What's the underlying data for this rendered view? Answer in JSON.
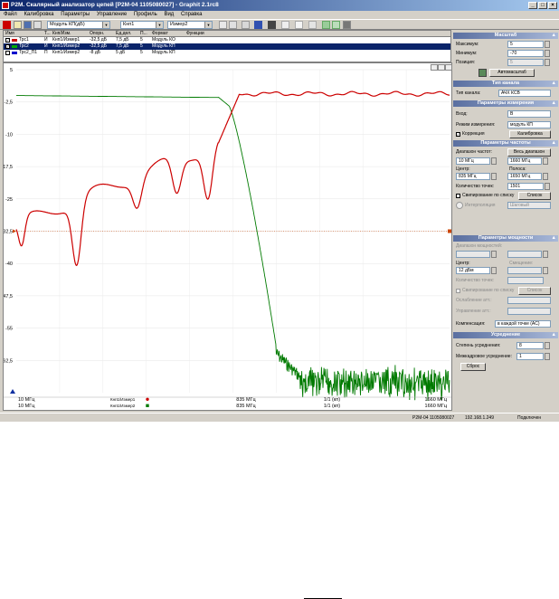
{
  "window": {
    "title": "P2M. Скалярный анализатор цепей [P2M-04 1105080027] - Graphit 2.1rc8",
    "controls": [
      "_",
      "□",
      "×"
    ]
  },
  "menu": [
    "Файл",
    "Калибровка",
    "Параметры",
    "Управление",
    "Профиль",
    "Вид",
    "Справка"
  ],
  "toolbar": {
    "mode_select": "Модуль КП(дБ)",
    "channel_select": "Кнп1",
    "meter_select": "Измер2"
  },
  "trace_table": {
    "headers": [
      "Имя",
      "Т...",
      "Кнп/Изм.",
      "Опорн.",
      "Ед.дел.",
      "П...",
      "Формат",
      "Функции"
    ],
    "rows": [
      {
        "checked": true,
        "color": "#cc0000",
        "cells": [
          "Трс1",
          "И",
          "Кнп1/Измер1",
          "-32,5 дБ",
          "7,5 дБ",
          "5",
          "Модуль КО",
          ""
        ]
      },
      {
        "checked": true,
        "color": "#00aa00",
        "cells": [
          "Трс2",
          "И",
          "Кнп1/Измер2",
          "-32,5 дБ",
          "7,5 дБ",
          "5",
          "Модуль КП",
          ""
        ]
      },
      {
        "checked": false,
        "color": "#0000cc",
        "cells": [
          "Трс2_П1",
          "П",
          "Кнп1/Измер2",
          "-8 дБ",
          "5 дБ",
          "5",
          "Модуль КП",
          ""
        ]
      }
    ]
  },
  "plot": {
    "y_ticks": [
      "5",
      "-2,5",
      "-10",
      "-17,5",
      "-25",
      "-32,5",
      "-40",
      "-47,5",
      "-55",
      "-62,5"
    ],
    "reference_label": "-32,5",
    "x_start": [
      "10 МГц",
      "10 МГц"
    ],
    "x_center": [
      "835 МГц",
      "835 МГц"
    ],
    "x_span": [
      "1/1 (кп)",
      "1/1 (кп)"
    ],
    "x_stop": [
      "1660 МГц",
      "1660 МГц"
    ],
    "legend": [
      "Кнп1/Измер1",
      "Кнп1/Измер2"
    ],
    "colors": {
      "reflection": "#cc0000",
      "transmission": "#007a00",
      "reference": "#cc4400"
    }
  },
  "panel": {
    "scale": {
      "title": "Масштаб",
      "max_label": "Максимум:",
      "max_value": "5",
      "min_label": "Минимум:",
      "min_value": "-70",
      "pos_label": "Позиция:",
      "pos_value": "5",
      "auto_button": "Автомасштаб"
    },
    "channel": {
      "title": "Тип канала",
      "type_label": "Тип канала:",
      "type_value": "АЧХ КСВ"
    },
    "measure": {
      "title": "Параметры измерения",
      "input_label": "Вход:",
      "input_value": "B",
      "mode_label": "Режим измерения:",
      "mode_value": "модуль КП",
      "correction_label": "Коррекция",
      "calib_button": "Калибровка"
    },
    "freq": {
      "title": "Параметры частоты",
      "range_label": "Диапазон частот:",
      "full_button": "Весь диапазон",
      "start_value": "10 МГц",
      "stop_value": "1660 МГц",
      "center_label": "Центр:",
      "span_label": "Полоса:",
      "center_value": "835 МГц",
      "span_value": "1650 МГц",
      "points_label": "Количество точек:",
      "points_value": "1501",
      "list_check": "Свипирование по списку",
      "list_button": "Список",
      "interp_label": "Интерполяция",
      "interp_value": "Шаговый"
    },
    "power": {
      "title": "Параметры мощности",
      "range_label": "Диапазон мощностей:",
      "center_label": "Центр:",
      "span_label": "Смещение:",
      "center_value": "12 дБм",
      "points_label": "Количество точек:",
      "list_check": "Свипирование по списку",
      "list_button": "Список",
      "atten_label": "Ослабление атт.:",
      "ctrl_label": "Управление атт.:",
      "comp_label": "Компенсация:",
      "comp_value": "в каждой точке (AC)"
    },
    "avg": {
      "title": "Усреднение",
      "degree_label": "Степень усреднения:",
      "degree_value": "8",
      "inter_label": "Межкадровое усреднение:",
      "inter_value": "1",
      "reset_button": "Сброс"
    }
  },
  "status": {
    "device": "P2M-04 1105080027",
    "ip": "192.168.1.249",
    "state": "Подключен"
  }
}
